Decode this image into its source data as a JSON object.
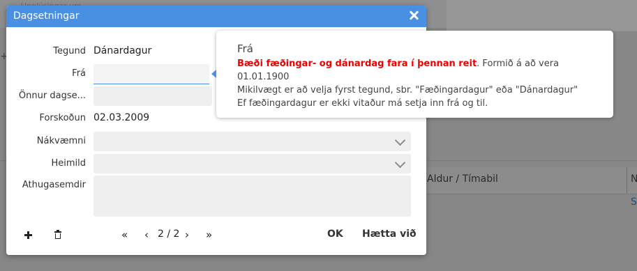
{
  "background": {
    "faint_text": "Upplýsingar um",
    "table_header": "Aldur / Tímabil",
    "column_n": "N",
    "link_s": "S",
    "plus": "+"
  },
  "dialog": {
    "title": "Dagsetningar",
    "fields": {
      "tegund_label": "Tegund",
      "tegund_value": "Dánardagur",
      "fra_label": "Frá",
      "fra_value": "",
      "onnur_label": "Önnur dagse...",
      "forskodun_label": "Forskoðun",
      "forskodun_value": "02.03.2009",
      "nakvaemni_label": "Nákvæmni",
      "heimild_label": "Heimild",
      "athugasemdir_label": "Athugasemdir"
    },
    "footer": {
      "pager_first": "«",
      "pager_prev": "‹",
      "pager_text": "2 / 2",
      "pager_next": "›",
      "pager_last": "»",
      "ok_label": "OK",
      "cancel_label": "Hætta við"
    }
  },
  "tooltip": {
    "title": "Frá",
    "warning": "Bæði fæðingar- og dánardag fara í þennan reit",
    "line1_rest": ". Formið á að vera 01.01.1900",
    "line2": "Mikilvægt er að velja fyrst tegund, sbr. \"Fæðingardagur\" eða \"Dánardagur\"",
    "line3": "Ef fæðingardagur er ekki vitaður má setja inn frá og til."
  },
  "colors": {
    "accent": "#4a90e2",
    "warning": "#e00000",
    "overlay": "#878787"
  }
}
